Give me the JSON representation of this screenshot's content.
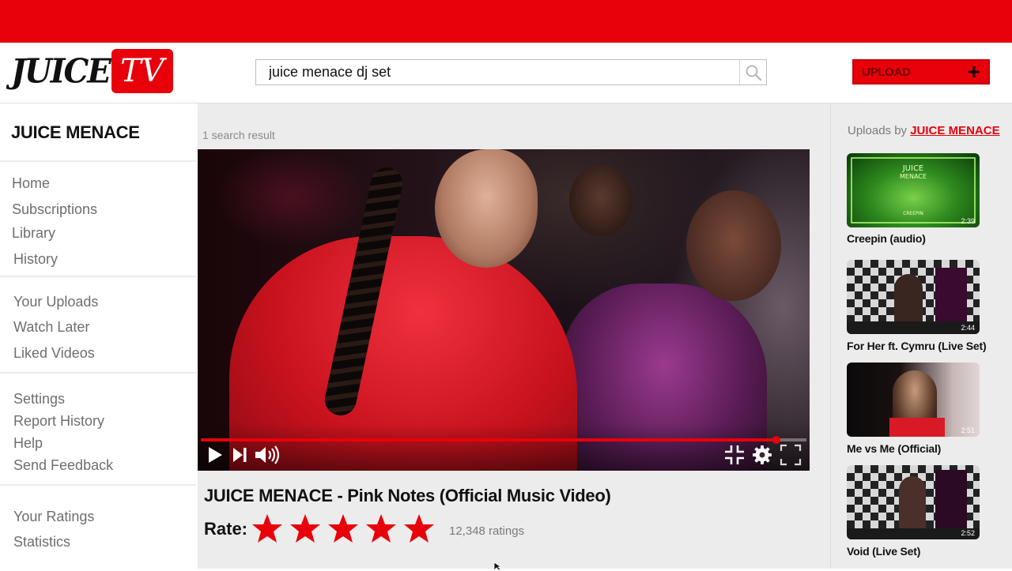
{
  "brand": {
    "logo_word": "JUICE",
    "logo_badge": "TV"
  },
  "search": {
    "value": "juice menace dj set",
    "placeholder": ""
  },
  "upload": {
    "label": "UPLOAD"
  },
  "sidebar": {
    "channel": "JUICE MENACE",
    "groups": [
      [
        "Home",
        "Subscriptions",
        "Library",
        "History"
      ],
      [
        "Your Uploads",
        "Watch Later",
        "Liked Videos"
      ],
      [
        "Settings",
        "Report History",
        "Help",
        "Send Feedback"
      ],
      [
        "Your Ratings",
        "Statistics"
      ]
    ]
  },
  "results": {
    "count_label": "1 search result"
  },
  "video": {
    "title": "JUICE MENACE - Pink Notes (Official Music Video)",
    "progress": 0.95,
    "rate_label": "Rate:",
    "stars": 5,
    "ratings_count": "12,348 ratings",
    "star_color": "#e8000a"
  },
  "uploads": {
    "prefix": "Uploads by",
    "channel": "JUICE MENACE",
    "items": [
      {
        "title": "Creepin (audio)",
        "duration": "2:39"
      },
      {
        "title": "For Her ft. Cymru (Live Set)",
        "duration": "2:44"
      },
      {
        "title": "Me vs Me (Official)",
        "duration": "2:51"
      },
      {
        "title": "Void (Live Set)",
        "duration": "2:52"
      }
    ]
  },
  "colors": {
    "accent": "#e8000a",
    "panel": "#ececec"
  },
  "icons": [
    "search-icon",
    "plus-icon",
    "play-icon",
    "next-icon",
    "volume-icon",
    "miniplayer-icon",
    "gear-icon",
    "fullscreen-icon"
  ]
}
